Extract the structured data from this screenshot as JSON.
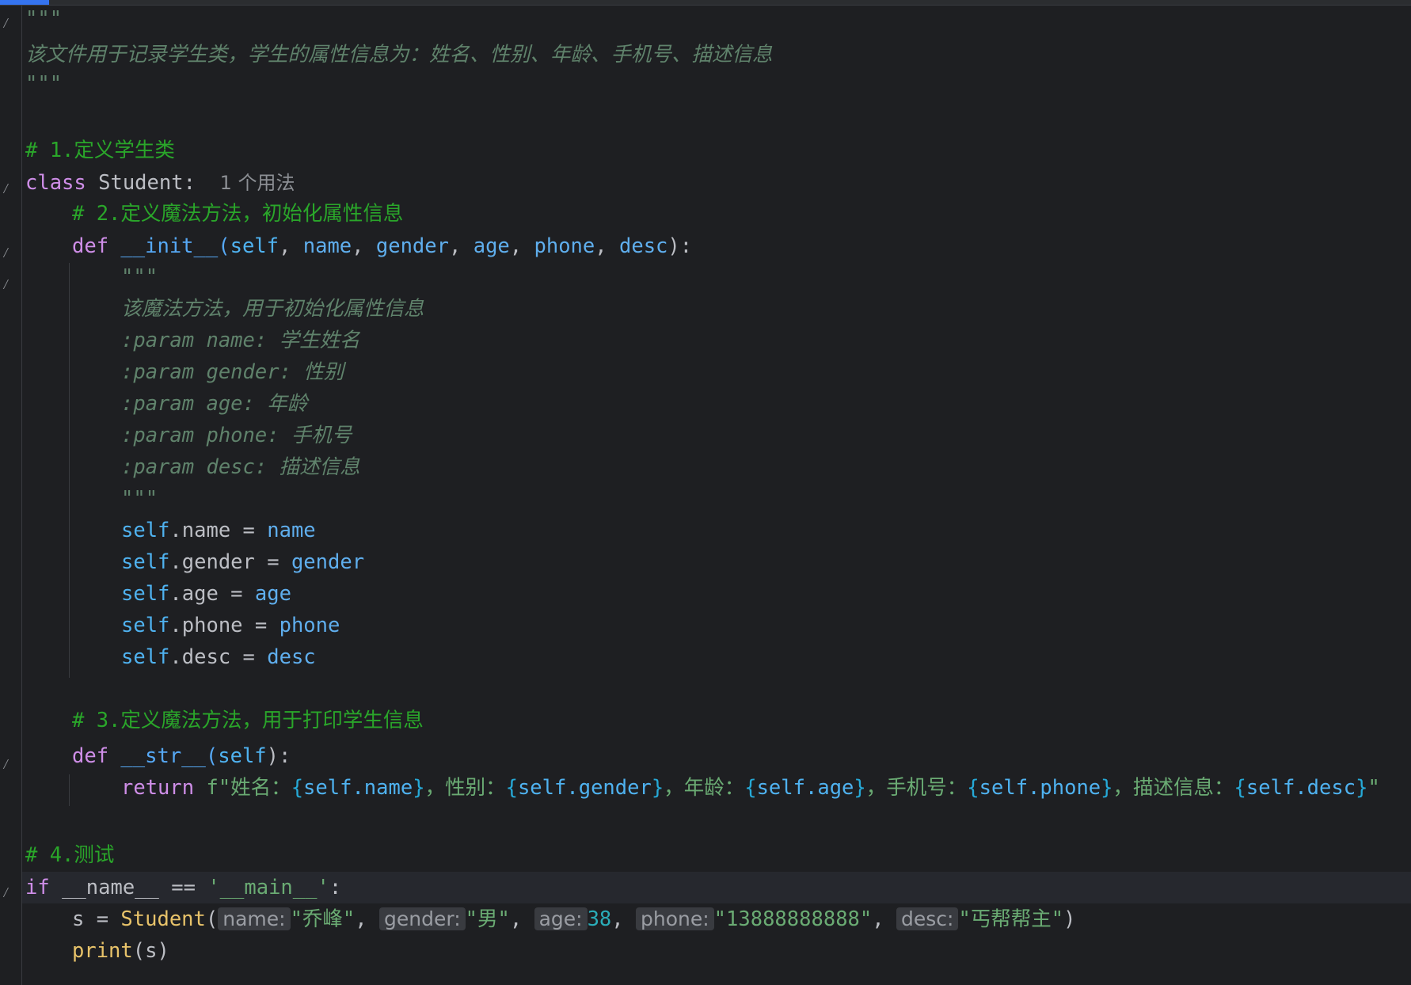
{
  "docstring_quotes": "\"\"\"",
  "file_doc": "该文件用于记录学生类，学生的属性信息为：姓名、性别、年龄、手机号、描述信息",
  "comment1": "# 1.定义学生类",
  "class_kw": "class",
  "class_name": " Student:",
  "usage_hint": "1 个用法",
  "comment2": "# 2.定义魔法方法，初始化属性信息",
  "def_kw": "def",
  "init_name": " __init__(",
  "init_params": {
    "self": "self",
    "name": "name",
    "gender": "gender",
    "age": "age",
    "phone": "phone",
    "desc": "desc"
  },
  "init_doc": {
    "desc": "该魔法方法，用于初始化属性信息",
    "p_name": ":param name: 学生姓名",
    "p_gender": ":param gender: 性别",
    "p_age": ":param age: 年龄",
    "p_phone": ":param phone: 手机号",
    "p_desc": ":param desc: 描述信息"
  },
  "assigns": [
    {
      "attr": ".name = ",
      "val": "name"
    },
    {
      "attr": ".gender = ",
      "val": "gender"
    },
    {
      "attr": ".age = ",
      "val": "age"
    },
    {
      "attr": ".phone = ",
      "val": "phone"
    },
    {
      "attr": ".desc = ",
      "val": "desc"
    }
  ],
  "comment3": "# 3.定义魔法方法，用于打印学生信息",
  "str_name": " __str__(",
  "return_kw": "return",
  "fstring": {
    "prefix": " f\"姓名：",
    "name_expr": "self.name",
    "gender_lbl": "，性别：",
    "gender_expr": "self.gender",
    "age_lbl": "，年龄：",
    "age_expr": "self.age",
    "phone_lbl": "，手机号：",
    "phone_expr": "self.phone",
    "desc_lbl": "，描述信息：",
    "desc_expr": "self.desc",
    "end": "\""
  },
  "comment4": "# 4.测试",
  "if_kw": "if",
  "main_check": " __name__ == ",
  "main_str": "'__main__'",
  "s_assign": "s = ",
  "ctor": "Student",
  "call_args": {
    "name_hint": "name:",
    "name_val": "\"乔峰\"",
    "gender_hint": "gender:",
    "gender_val": "\"男\"",
    "age_hint": "age:",
    "age_val": "38",
    "phone_hint": "phone:",
    "phone_val": "\"13888888888\"",
    "desc_hint": "desc:",
    "desc_val": "\"丐帮帮主\""
  },
  "print_fn": "print",
  "print_args": "(s)"
}
